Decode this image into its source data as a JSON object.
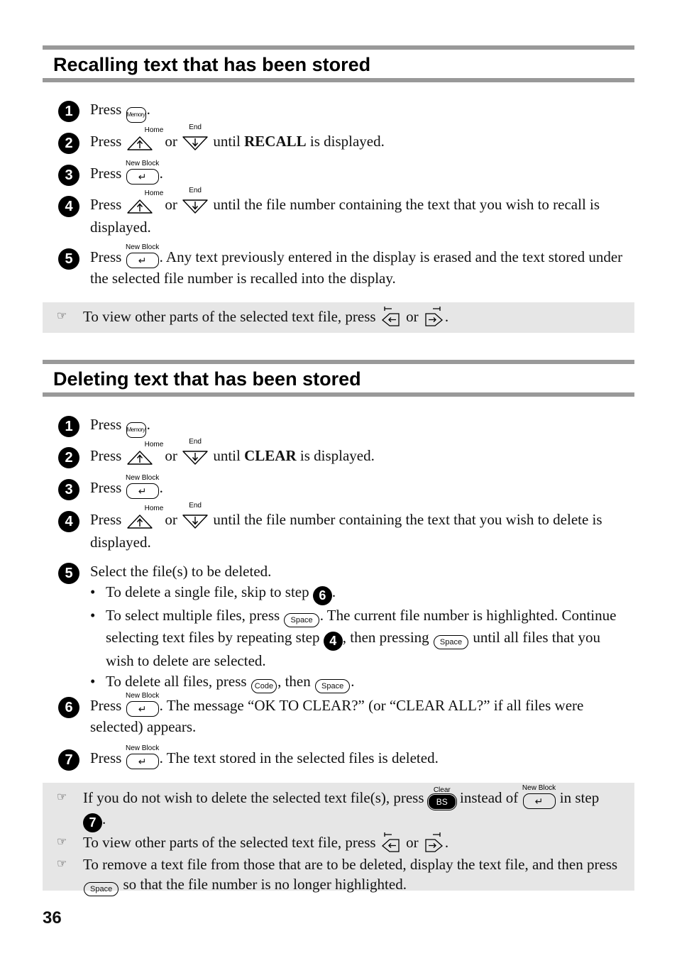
{
  "page_number": "36",
  "keys": {
    "memory": "Memory",
    "home": "Home",
    "end": "End",
    "new_block": "New Block",
    "enter_glyph": "↵",
    "space": "Space",
    "code": "Code",
    "clear": "Clear",
    "bs": "BS"
  },
  "recall": {
    "title": "Recalling text that has been stored",
    "steps": [
      {
        "num": "1",
        "press": "Press",
        "end": "."
      },
      {
        "num": "2",
        "press": "Press",
        "or": "or",
        "until": "until",
        "bold": "RECALL",
        "rest": "is displayed."
      },
      {
        "num": "3",
        "press": "Press",
        "end": "."
      },
      {
        "num": "4",
        "press": "Press",
        "or": "or",
        "rest": "until the file number containing the text that you wish to recall is displayed."
      },
      {
        "num": "5",
        "press": "Press",
        "rest": ". Any text previously entered in the display is erased and the text stored under the selected file number is recalled into the display."
      }
    ],
    "note": {
      "text": "To view other parts of the selected text file, press",
      "or": "or",
      "end": "."
    }
  },
  "delete": {
    "title": "Deleting text that has been stored",
    "steps": [
      {
        "num": "1",
        "press": "Press",
        "end": "."
      },
      {
        "num": "2",
        "press": "Press",
        "or": "or",
        "until": "until",
        "bold": "CLEAR",
        "rest": "is displayed."
      },
      {
        "num": "3",
        "press": "Press",
        "end": "."
      },
      {
        "num": "4",
        "press": "Press",
        "or": "or",
        "rest": "until the file number containing the text that you wish to delete is displayed."
      },
      {
        "num": "5",
        "text": "Select the file(s) to be deleted.",
        "bullets": [
          {
            "a": "To delete a single file, skip to step",
            "ref": "6",
            "b": "."
          },
          {
            "a": "To select multiple files, press",
            "b": ". The current file number is highlighted. Continue selecting text files by repeating step",
            "ref": "4",
            "c": ", then pressing",
            "d": "until all files that you wish to delete are selected."
          },
          {
            "a": "To delete all files, press",
            "b": ", then",
            "c": "."
          }
        ]
      },
      {
        "num": "6",
        "press": "Press",
        "rest": ". The message “OK TO CLEAR?” (or “CLEAR ALL?” if all files were selected) appears."
      },
      {
        "num": "7",
        "press": "Press",
        "rest": ". The text stored in the selected files is deleted."
      }
    ],
    "notes": [
      {
        "a": "If you do not wish to delete the selected text file(s), press",
        "b": "instead of",
        "c": "in step",
        "ref": "7",
        "d": "."
      },
      {
        "a": "To view other parts of the selected text file, press",
        "b": "or",
        "c": "."
      },
      {
        "a": "To remove a text file from those that are to be deleted, display the text file, and then press",
        "b": "so that the file number is no longer highlighted."
      }
    ]
  }
}
